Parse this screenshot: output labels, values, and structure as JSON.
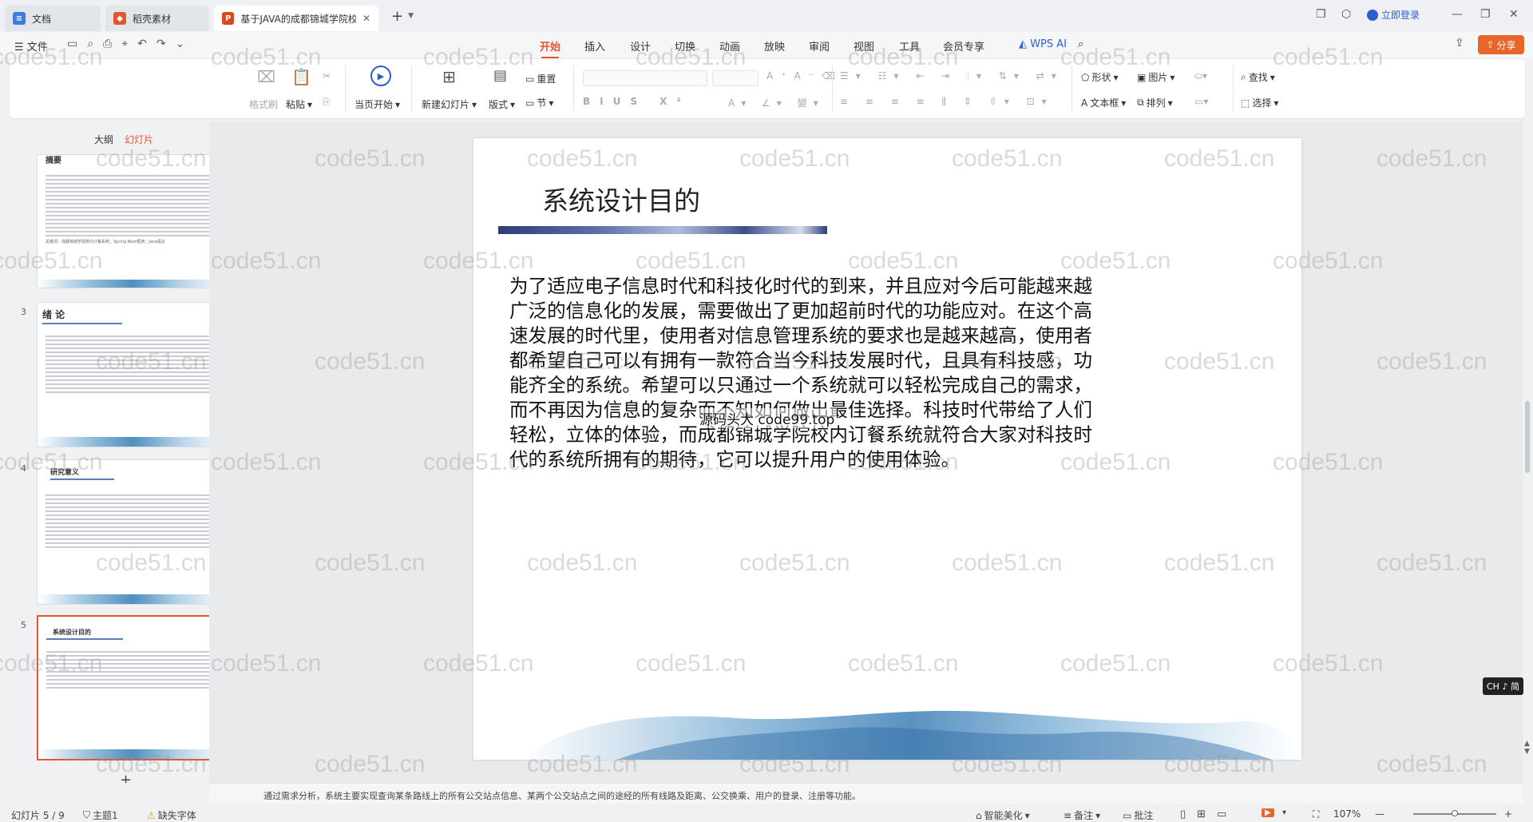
{
  "tabs": [
    {
      "label": "文档",
      "icon": "doc-icon"
    },
    {
      "label": "稻壳素材",
      "icon": "docer-icon"
    },
    {
      "label": "基于JAVA的成都锦城学院校",
      "icon": "ppt-icon"
    }
  ],
  "window": {
    "login_label": "立即登录"
  },
  "menubar": {
    "file_label": "文件",
    "tabs": [
      "开始",
      "插入",
      "设计",
      "切换",
      "动画",
      "放映",
      "审阅",
      "视图",
      "工具",
      "会员专享"
    ],
    "wps_ai_label": "WPS AI",
    "share_label": "分享"
  },
  "ribbon": {
    "format_painter": "格式刷",
    "paste": "粘贴",
    "from_current": "当页开始",
    "new_slide": "新建幻灯片",
    "layout": "版式",
    "section": "节",
    "reset": "重置",
    "shape": "形状",
    "picture": "图片",
    "textbox": "文本框",
    "arrange": "排列",
    "find": "查找",
    "select": "选择"
  },
  "leftpane": {
    "outline_label": "大纲",
    "slides_label": "幻灯片",
    "thumbs": [
      {
        "num": "",
        "title": "摘要",
        "caption": "关键词：成都锦城学院校内订餐系统；Spring Boot框架；Java语言"
      },
      {
        "num": "3",
        "title": "绪  论"
      },
      {
        "num": "4",
        "title": "研究意义"
      },
      {
        "num": "5",
        "title": "系统设计目的"
      }
    ]
  },
  "slide": {
    "title": "系统设计目的",
    "body": "为了适应电子信息时代和科技化时代的到来，并且应对今后可能越来越广泛的信息化的发展，需要做出了更加超前时代的功能应对。在这个高速发展的时代里，使用者对信息管理系统的要求也是越来越高，使用者都希望自己可以有拥有一款符合当今科技发展时代，且具有科技感，功能齐全的系统。希望可以只通过一个系统就可以轻松完成自己的需求，而不再因为信息的复杂而不知如何做出最佳选择。科技时代带给了人们轻松，立体的体验，而成都锦城学院校内订餐系统就符合大家对科技时代的系统所拥有的期待，它可以提升用户的使用体验。",
    "overlay_text": "源码头大 code99.top"
  },
  "notes": "通过需求分析，系统主要实现查询某条路线上的所有公交站点信息、某两个公交站点之间的途经的所有线路及距离、公交换乘、用户的登录、注册等功能。",
  "status": {
    "slide_pos": "幻灯片 5 / 9",
    "theme": "主题1",
    "missing_font": "缺失字体",
    "beautify": "智能美化",
    "notes_btn": "备注",
    "comment_btn": "批注",
    "zoom": "107%",
    "ime": "CH ♪ 简"
  },
  "watermark": "code51.cn",
  "colors": {
    "accent": "#e4572e",
    "selected_border": "#e4572e"
  }
}
